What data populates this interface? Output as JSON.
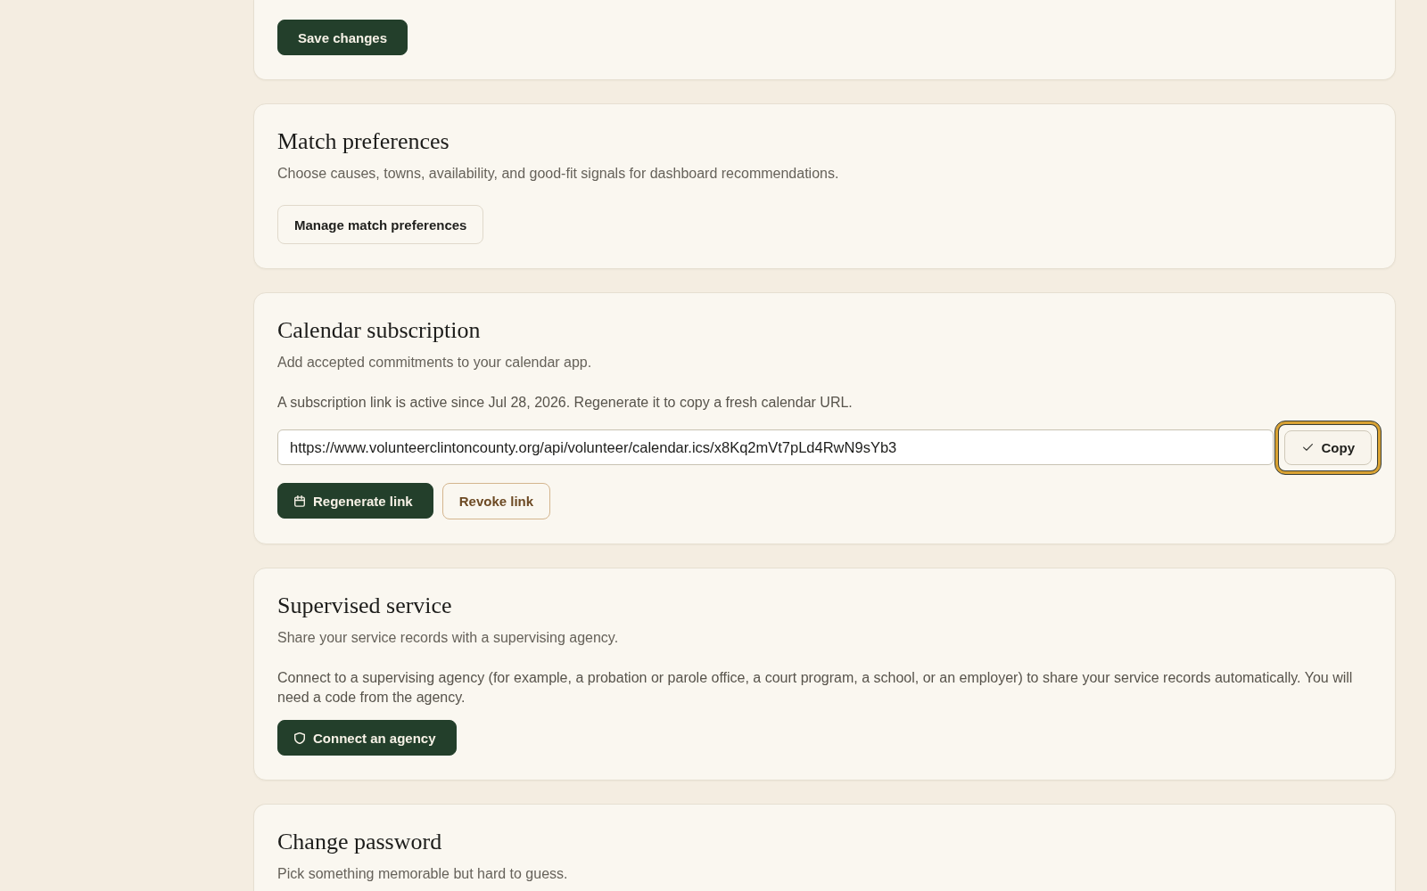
{
  "sections": [
    {
      "kind": "form-end",
      "buttons": [
        {
          "label": "Save changes",
          "kind": "primary"
        }
      ]
    },
    {
      "kind": "preferences",
      "title": "Match preferences",
      "description": "Choose causes, towns, availability, and good-fit signals for dashboard recommendations.",
      "buttons": [
        {
          "label": "Manage match preferences",
          "kind": "secondary"
        }
      ]
    },
    {
      "kind": "calendar",
      "title": "Calendar subscription",
      "description": "Add accepted commitments to your calendar app.",
      "note": "A subscription link is active since Jul 28, 2026. Regenerate it to copy a fresh calendar URL.",
      "link_field": {
        "value": "https://www.volunteerclintoncounty.org/api/volunteer/calendar.ics/x8Kq2mVt7pLd4RwN9sYb3",
        "copy_button": {
          "label": "Copy",
          "focused": true,
          "icon": true
        }
      },
      "buttons": [
        {
          "label": "Regenerate link",
          "kind": "primary",
          "icon": true
        },
        {
          "label": "Revoke link",
          "kind": "outline"
        }
      ]
    },
    {
      "kind": "supervision",
      "title": "Supervised service",
      "description": "Share your service records with a supervising agency.",
      "note": "Connect to a supervising agency (for example, a probation or parole office, a court program, a school, or an employer) to share your service records automatically. You will need a code from the agency.",
      "buttons": [
        {
          "label": "Connect an agency",
          "kind": "primary",
          "icon": true
        }
      ]
    },
    {
      "kind": "password",
      "title": "Change password",
      "description": "Pick something memorable but hard to guess."
    }
  ]
}
